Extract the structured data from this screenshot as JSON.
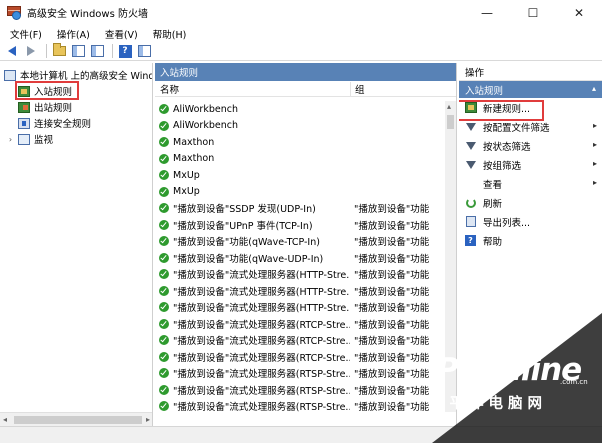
{
  "window": {
    "title": "高级安全 Windows 防火墙",
    "minimize": "—",
    "maximize": "☐",
    "close": "✕"
  },
  "menu": {
    "items": [
      "文件(F)",
      "操作(A)",
      "查看(V)",
      "帮助(H)"
    ]
  },
  "tree": {
    "root": "本地计算机 上的高级安全 Windows",
    "items": [
      {
        "label": "入站规则",
        "icon": "inbound-rules-icon",
        "selected": true
      },
      {
        "label": "出站规则",
        "icon": "outbound-rules-icon"
      },
      {
        "label": "连接安全规则",
        "icon": "connection-security-icon"
      },
      {
        "label": "监视",
        "icon": "monitor-icon",
        "expander": "›"
      }
    ]
  },
  "center": {
    "title": "入站规则",
    "columns": {
      "name": "名称",
      "group": "组"
    },
    "rows": [
      {
        "name": "AliWorkbench",
        "group": ""
      },
      {
        "name": "AliWorkbench",
        "group": ""
      },
      {
        "name": "Maxthon",
        "group": ""
      },
      {
        "name": "Maxthon",
        "group": ""
      },
      {
        "name": "MxUp",
        "group": ""
      },
      {
        "name": "MxUp",
        "group": ""
      },
      {
        "name": "\"播放到设备\"SSDP 发现(UDP-In)",
        "group": "\"播放到设备\"功能"
      },
      {
        "name": "\"播放到设备\"UPnP 事件(TCP-In)",
        "group": "\"播放到设备\"功能"
      },
      {
        "name": "\"播放到设备\"功能(qWave-TCP-In)",
        "group": "\"播放到设备\"功能"
      },
      {
        "name": "\"播放到设备\"功能(qWave-UDP-In)",
        "group": "\"播放到设备\"功能"
      },
      {
        "name": "\"播放到设备\"流式处理服务器(HTTP-Stre...",
        "group": "\"播放到设备\"功能"
      },
      {
        "name": "\"播放到设备\"流式处理服务器(HTTP-Stre...",
        "group": "\"播放到设备\"功能"
      },
      {
        "name": "\"播放到设备\"流式处理服务器(HTTP-Stre...",
        "group": "\"播放到设备\"功能"
      },
      {
        "name": "\"播放到设备\"流式处理服务器(RTCP-Stre...",
        "group": "\"播放到设备\"功能"
      },
      {
        "name": "\"播放到设备\"流式处理服务器(RTCP-Stre...",
        "group": "\"播放到设备\"功能"
      },
      {
        "name": "\"播放到设备\"流式处理服务器(RTCP-Stre...",
        "group": "\"播放到设备\"功能"
      },
      {
        "name": "\"播放到设备\"流式处理服务器(RTSP-Stre...",
        "group": "\"播放到设备\"功能"
      },
      {
        "name": "\"播放到设备\"流式处理服务器(RTSP-Stre...",
        "group": "\"播放到设备\"功能"
      },
      {
        "name": "\"播放到设备\"流式处理服务器(RTSP-Stre...",
        "group": "\"播放到设备\"功能"
      }
    ]
  },
  "actions": {
    "title": "操作",
    "section": "入站规则",
    "items": [
      {
        "label": "新建规则...",
        "icon": "new-rule-icon",
        "highlighted": true
      },
      {
        "label": "按配置文件筛选",
        "icon": "filter-icon",
        "submenu": true
      },
      {
        "label": "按状态筛选",
        "icon": "filter-icon",
        "submenu": true
      },
      {
        "label": "按组筛选",
        "icon": "filter-icon",
        "submenu": true
      },
      {
        "label": "查看",
        "icon": "",
        "submenu": true
      },
      {
        "label": "刷新",
        "icon": "refresh-icon"
      },
      {
        "label": "导出列表...",
        "icon": "export-icon"
      },
      {
        "label": "帮助",
        "icon": "help-icon"
      }
    ]
  },
  "watermark": {
    "logo": "PConline",
    "domain": ".com.cn",
    "subtitle": "太平洋电脑网"
  },
  "colors": {
    "pane_header": "#5882b6",
    "highlight_box": "#e03c3c",
    "check_green": "#2e9a2e"
  }
}
